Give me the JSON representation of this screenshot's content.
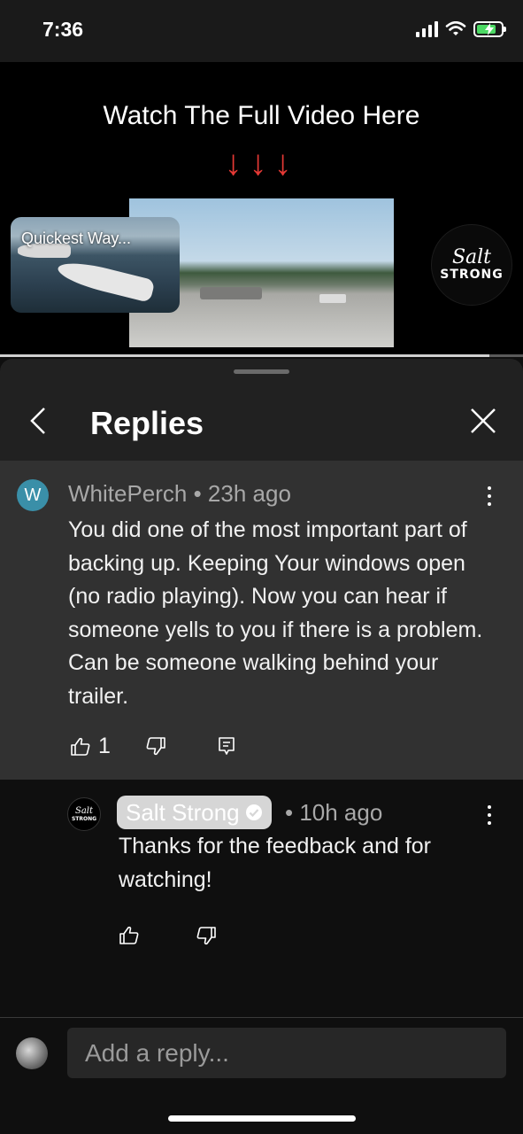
{
  "status_bar": {
    "time": "7:36"
  },
  "video": {
    "title": "Watch The Full Video Here",
    "arrows": "↓↓↓",
    "thumbnail_label": "Quickest Way...",
    "brand_logo": {
      "script": "Salt",
      "word": "STRONG"
    },
    "progress_fraction": 0.935
  },
  "panel": {
    "title": "Replies"
  },
  "comment": {
    "avatar_letter": "W",
    "avatar_color": "#3a8fa8",
    "meta": "WhitePerch • 23h ago",
    "text": "You did one of the most important part of backing up.  Keeping Your windows open (no radio playing). Now you can hear if someone yells to you if there is a problem.  Can be someone walking behind your trailer.",
    "like_count": "1"
  },
  "reply": {
    "author": "Salt Strong",
    "time": "• 10h ago",
    "text": "Thanks for the feedback and for watching!",
    "avatar": {
      "script": "Salt",
      "word": "STRONG"
    }
  },
  "composer": {
    "placeholder": "Add a reply..."
  }
}
